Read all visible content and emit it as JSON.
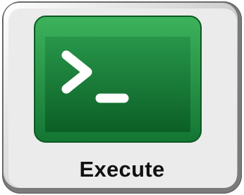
{
  "button": {
    "label": "Execute",
    "icon": "terminal-icon"
  },
  "colors": {
    "frame_dark": "#7a7a7a",
    "panel_light": "#ebebeb",
    "icon_green_top": "#2e9a4e",
    "icon_green_bottom": "#0f6a2c",
    "icon_glyph": "#ffffff",
    "label_text": "#111111"
  }
}
